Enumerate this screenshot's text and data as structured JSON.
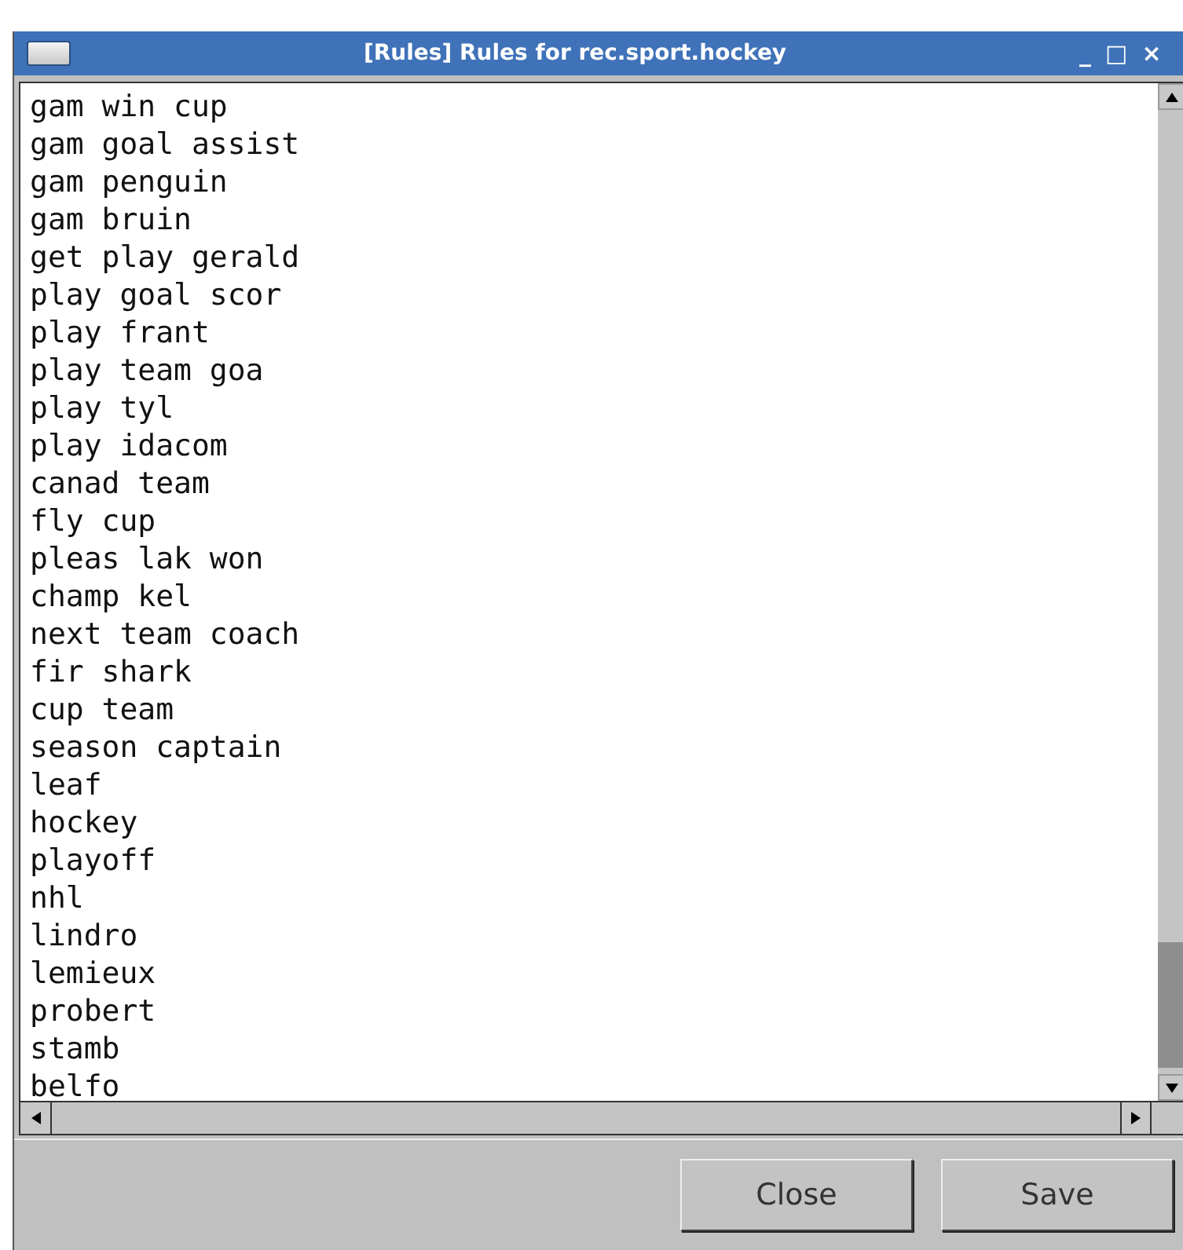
{
  "window": {
    "title": "[Rules] Rules for rec.sport.hockey",
    "controls": [
      "_",
      "□",
      "×"
    ]
  },
  "lines": [
    "gam win cup",
    "gam goal assist",
    "gam penguin",
    "gam bruin",
    "get play gerald",
    "play goal scor",
    "play frant",
    "play team goa",
    "play tyl",
    "play idacom",
    "canad team",
    "fly cup",
    "pleas lak won",
    "champ kel",
    "next team coach",
    "fir shark",
    "cup team",
    "season captain",
    "leaf",
    "hockey",
    "playoff",
    "nhl",
    "lindro",
    "lemieux",
    "probert",
    "stamb",
    "belfo"
  ],
  "buttons": [
    "Close",
    "Save"
  ]
}
